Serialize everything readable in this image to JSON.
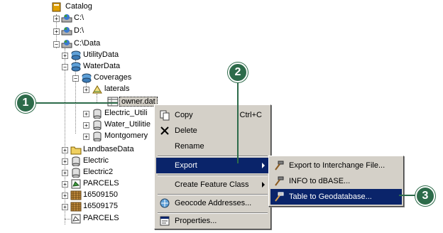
{
  "tree": {
    "catalog": "Catalog",
    "c_drive": "C:\\",
    "d_drive": "D:\\",
    "c_data": "C:\\Data",
    "utility_data": "UtilityData",
    "water_data": "WaterData",
    "coverages": "Coverages",
    "laterals": "laterals",
    "owner_dat": "owner.dat",
    "electric_util": "Electric_Utili",
    "water_util": "Water_Utilitie",
    "montgomery": "Montgomery",
    "landbase_data": "LandbaseData",
    "electric": "Electric",
    "electric2": "Electric2",
    "parcels_upper": "PARCELS",
    "n16509150": "16509150",
    "n16509175": "16509175",
    "parcels_lower": "PARCELS"
  },
  "context_menu": {
    "copy": "Copy",
    "copy_shortcut": "Ctrl+C",
    "delete": "Delete",
    "rename": "Rename",
    "export": "Export",
    "create_feature_class": "Create Feature Class",
    "geocode_addresses": "Geocode Addresses...",
    "properties": "Properties..."
  },
  "export_submenu": {
    "interchange": "Export to Interchange File...",
    "info_dbase": "INFO to dBASE...",
    "table_geodatabase": "Table to Geodatabase..."
  },
  "callouts": {
    "one": "1",
    "two": "2",
    "three": "3"
  },
  "colors": {
    "callout": "#2d6b4a",
    "menu_bg": "#d4d0c8",
    "highlight": "#0a246a"
  }
}
